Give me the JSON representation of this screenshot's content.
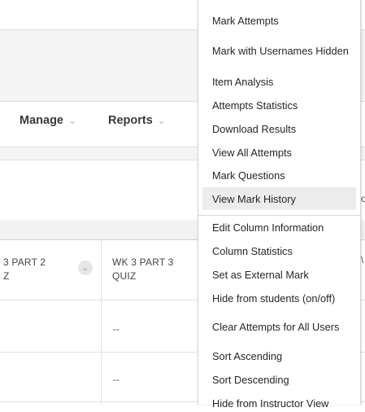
{
  "toolbar": {
    "manage_label": "Manage",
    "reports_label": "Reports",
    "chevron": "⌄"
  },
  "grid": {
    "columns": [
      {
        "header": "3 PART 2\nZ",
        "options_icon": "chevron-down-icon"
      },
      {
        "header": "WK 3 PART 3\nQUIZ"
      }
    ],
    "rows": [
      {
        "col2": "--"
      },
      {
        "col2": "--"
      }
    ],
    "right_edge_chars": [
      "o",
      "\\"
    ]
  },
  "menu": {
    "items": [
      {
        "label": "Mark Attempts"
      },
      {
        "label": "Mark with Usernames Hidden"
      },
      {
        "label": "Item Analysis"
      },
      {
        "label": "Attempts Statistics"
      },
      {
        "label": "Download Results"
      },
      {
        "label": "View All Attempts"
      },
      {
        "label": "Mark Questions"
      },
      {
        "label": "View Mark History",
        "highlighted": true
      },
      {
        "label": "Edit Column Information"
      },
      {
        "label": "Column Statistics"
      },
      {
        "label": "Set as External Mark"
      },
      {
        "label": "Hide from students (on/off)"
      },
      {
        "label": "Clear Attempts for All Users"
      },
      {
        "label": "Sort Ascending"
      },
      {
        "label": "Sort Descending"
      },
      {
        "label": "Hide from Instructor View"
      }
    ]
  }
}
